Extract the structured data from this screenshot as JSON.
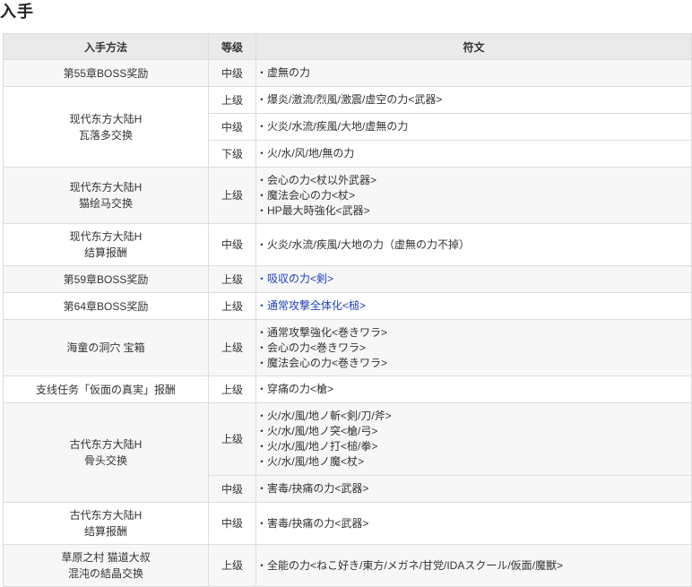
{
  "page_title": "入手",
  "table": {
    "headers": {
      "method": "入手方法",
      "grade": "等级",
      "rune": "符文"
    },
    "groups": [
      {
        "method": [
          "第55章BOSS奖励"
        ],
        "rows": [
          {
            "grade": "中级",
            "runes": [
              "・虚無の力"
            ],
            "h": 30
          }
        ]
      },
      {
        "method": [
          "现代东方大陆H",
          "瓦落多交换"
        ],
        "rows": [
          {
            "grade": "上级",
            "runes": [
              "・爆炎/激流/烈風/激震/虚空の力<武器>"
            ],
            "h": 30
          },
          {
            "grade": "中级",
            "runes": [
              "・火炎/水流/疾風/大地/虚無の力"
            ],
            "h": 30
          },
          {
            "grade": "下级",
            "runes": [
              "・火/水/风/地/無の力"
            ],
            "h": 30
          }
        ]
      },
      {
        "method": [
          "现代东方大陆H",
          "猫绘马交换"
        ],
        "rows": [
          {
            "grade": "上级",
            "runes": [
              "・会心の力<杖以外武器>",
              "・魔法会心の力<杖>",
              "・HP最大時強化<武器>"
            ],
            "h": 63
          }
        ]
      },
      {
        "method": [
          "现代东方大陆H",
          "结算报酬"
        ],
        "rows": [
          {
            "grade": "中级",
            "runes": [
              "・火炎/水流/疾風/大地の力（虚無の力不掉）"
            ],
            "h": 47
          }
        ]
      },
      {
        "method": [
          "第59章BOSS奖励"
        ],
        "rows": [
          {
            "grade": "上级",
            "runes": [
              "・吸収の力<剣>"
            ],
            "link": true,
            "h": 30
          }
        ]
      },
      {
        "method": [
          "第64章BOSS奖励"
        ],
        "rows": [
          {
            "grade": "上级",
            "runes": [
              "・通常攻撃全体化<槌>"
            ],
            "link": true,
            "h": 30
          }
        ]
      },
      {
        "method": [
          "海童の洞穴 宝箱"
        ],
        "rows": [
          {
            "grade": "上级",
            "runes": [
              "・通常攻撃強化<巻きワラ>",
              "・会心の力<巻きワラ>",
              "・魔法会心の力<巻きワラ>"
            ],
            "h": 63
          }
        ]
      },
      {
        "method": [
          "支线任务「仮面の真実」报酬"
        ],
        "rows": [
          {
            "grade": "上级",
            "runes": [
              "・穿痛の力<槍>"
            ],
            "h": 30
          }
        ]
      },
      {
        "method": [
          "古代东方大陆H",
          "骨头交换"
        ],
        "rows": [
          {
            "grade": "上级",
            "runes": [
              "・火/水/風/地ノ斬<剣/刀/斧>",
              "・火/水/風/地ノ突<槍/弓>",
              "・火/水/風/地ノ打<槌/拳>",
              "・火/水/風/地ノ魔<杖>"
            ],
            "h": 81
          },
          {
            "grade": "中级",
            "runes": [
              "・害毒/抉痛の力<武器>"
            ],
            "h": 30
          }
        ]
      },
      {
        "method": [
          "古代东方大陆H",
          "结算报酬"
        ],
        "rows": [
          {
            "grade": "中级",
            "runes": [
              "・害毒/抉痛の力<武器>"
            ],
            "h": 47
          }
        ]
      },
      {
        "method": [
          "草原之村 猫道大叔",
          "混沌の結晶交换"
        ],
        "rows": [
          {
            "grade": "上级",
            "runes": [
              "・全能の力<ねこ好き/東方/メガネ/甘党/IDAスクール/仮面/魔獣>"
            ],
            "h": 47
          }
        ]
      }
    ]
  }
}
